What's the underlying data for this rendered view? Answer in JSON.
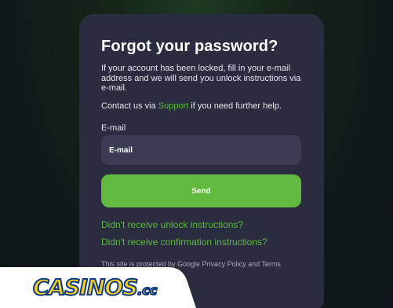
{
  "form": {
    "title": "Forgot your password?",
    "description": "If your account has been locked, fill in your e-mail address and we will send you unlock instructions via e-mail.",
    "contact_prefix": "Contact us via ",
    "contact_link": "Support",
    "contact_suffix": " if you need further help.",
    "email_label": "E-mail",
    "email_placeholder": "E-mail",
    "email_value": "",
    "send_label": "Send",
    "unlock_link": "Didn't receive unlock instructions?",
    "confirm_link": "Didn't receive confirmation instructions?",
    "protected_text": "This site is protected by Google Privacy Policy and Terms"
  },
  "watermark": {
    "logo_text": "CASINOS",
    "logo_suffix": ".cc"
  },
  "colors": {
    "accent": "#62b940",
    "link": "#5db83d",
    "card": "#2a2c3f",
    "input": "#3a3c55",
    "logo_yellow": "#f7d21f",
    "logo_blue": "#0e3a86"
  }
}
